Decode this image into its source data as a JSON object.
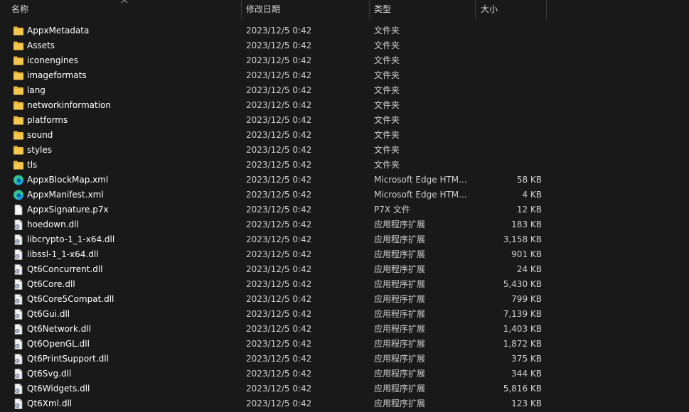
{
  "columns": {
    "name": "名称",
    "date": "修改日期",
    "type": "类型",
    "size": "大小"
  },
  "files": [
    {
      "name": "AppxMetadata",
      "date": "2023/12/5 0:42",
      "type": "文件夹",
      "size": "",
      "icon": "folder"
    },
    {
      "name": "Assets",
      "date": "2023/12/5 0:42",
      "type": "文件夹",
      "size": "",
      "icon": "folder"
    },
    {
      "name": "iconengines",
      "date": "2023/12/5 0:42",
      "type": "文件夹",
      "size": "",
      "icon": "folder"
    },
    {
      "name": "imageformats",
      "date": "2023/12/5 0:42",
      "type": "文件夹",
      "size": "",
      "icon": "folder"
    },
    {
      "name": "lang",
      "date": "2023/12/5 0:42",
      "type": "文件夹",
      "size": "",
      "icon": "folder"
    },
    {
      "name": "networkinformation",
      "date": "2023/12/5 0:42",
      "type": "文件夹",
      "size": "",
      "icon": "folder"
    },
    {
      "name": "platforms",
      "date": "2023/12/5 0:42",
      "type": "文件夹",
      "size": "",
      "icon": "folder"
    },
    {
      "name": "sound",
      "date": "2023/12/5 0:42",
      "type": "文件夹",
      "size": "",
      "icon": "folder"
    },
    {
      "name": "styles",
      "date": "2023/12/5 0:42",
      "type": "文件夹",
      "size": "",
      "icon": "folder"
    },
    {
      "name": "tls",
      "date": "2023/12/5 0:42",
      "type": "文件夹",
      "size": "",
      "icon": "folder"
    },
    {
      "name": "AppxBlockMap.xml",
      "date": "2023/12/5 0:42",
      "type": "Microsoft Edge HTM...",
      "size": "58 KB",
      "icon": "edge"
    },
    {
      "name": "AppxManifest.xml",
      "date": "2023/12/5 0:42",
      "type": "Microsoft Edge HTM...",
      "size": "4 KB",
      "icon": "edge"
    },
    {
      "name": "AppxSignature.p7x",
      "date": "2023/12/5 0:42",
      "type": "P7X 文件",
      "size": "12 KB",
      "icon": "file"
    },
    {
      "name": "hoedown.dll",
      "date": "2023/12/5 0:42",
      "type": "应用程序扩展",
      "size": "183 KB",
      "icon": "dll"
    },
    {
      "name": "libcrypto-1_1-x64.dll",
      "date": "2023/12/5 0:42",
      "type": "应用程序扩展",
      "size": "3,158 KB",
      "icon": "dll"
    },
    {
      "name": "libssl-1_1-x64.dll",
      "date": "2023/12/5 0:42",
      "type": "应用程序扩展",
      "size": "901 KB",
      "icon": "dll"
    },
    {
      "name": "Qt6Concurrent.dll",
      "date": "2023/12/5 0:42",
      "type": "应用程序扩展",
      "size": "24 KB",
      "icon": "dll"
    },
    {
      "name": "Qt6Core.dll",
      "date": "2023/12/5 0:42",
      "type": "应用程序扩展",
      "size": "5,430 KB",
      "icon": "dll"
    },
    {
      "name": "Qt6Core5Compat.dll",
      "date": "2023/12/5 0:42",
      "type": "应用程序扩展",
      "size": "799 KB",
      "icon": "dll"
    },
    {
      "name": "Qt6Gui.dll",
      "date": "2023/12/5 0:42",
      "type": "应用程序扩展",
      "size": "7,139 KB",
      "icon": "dll"
    },
    {
      "name": "Qt6Network.dll",
      "date": "2023/12/5 0:42",
      "type": "应用程序扩展",
      "size": "1,403 KB",
      "icon": "dll"
    },
    {
      "name": "Qt6OpenGL.dll",
      "date": "2023/12/5 0:42",
      "type": "应用程序扩展",
      "size": "1,872 KB",
      "icon": "dll"
    },
    {
      "name": "Qt6PrintSupport.dll",
      "date": "2023/12/5 0:42",
      "type": "应用程序扩展",
      "size": "375 KB",
      "icon": "dll"
    },
    {
      "name": "Qt6Svg.dll",
      "date": "2023/12/5 0:42",
      "type": "应用程序扩展",
      "size": "344 KB",
      "icon": "dll"
    },
    {
      "name": "Qt6Widgets.dll",
      "date": "2023/12/5 0:42",
      "type": "应用程序扩展",
      "size": "5,816 KB",
      "icon": "dll"
    },
    {
      "name": "Qt6Xml.dll",
      "date": "2023/12/5 0:42",
      "type": "应用程序扩展",
      "size": "123 KB",
      "icon": "dll"
    }
  ],
  "colors": {
    "background": "#191919",
    "folder": "#e8b53a",
    "edge_primary": "#1b9de2",
    "edge_secondary": "#34c68c"
  }
}
